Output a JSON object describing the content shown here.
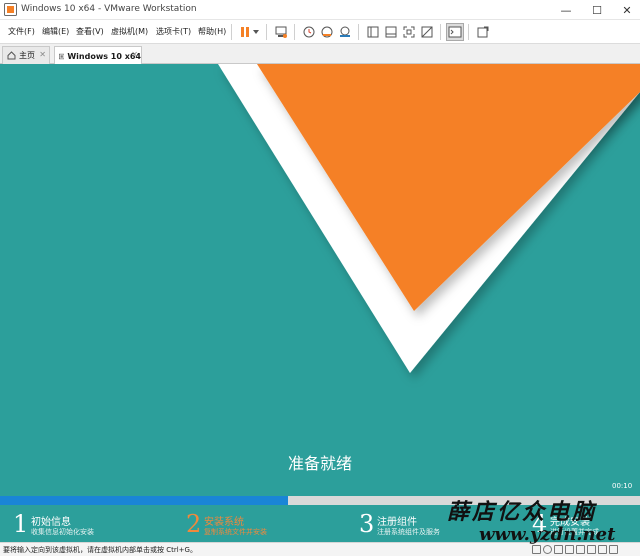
{
  "window": {
    "title": "Windows 10 x64 - VMware Workstation",
    "minimize": "—",
    "maximize": "☐",
    "close": "✕"
  },
  "menu": {
    "items": [
      "文件(F)",
      "编辑(E)",
      "查看(V)",
      "虚拟机(M)",
      "选项卡(T)",
      "帮助(H)"
    ]
  },
  "toolbar": {
    "icons": [
      "pause-icon",
      "dropdown-arrow-icon",
      "send-ctrl-alt-del-icon",
      "snapshot-take-icon",
      "snapshot-revert-icon",
      "snapshot-manager-icon",
      "sidebar-toggle-icon",
      "thumbnail-bar-icon",
      "fullscreen-icon",
      "unity-icon",
      "console-view-icon",
      "stretch-guest-icon"
    ]
  },
  "tabs": [
    {
      "label": "主页",
      "icon": "home-icon",
      "close": "✕"
    },
    {
      "label": "Windows 10 x64",
      "icon": "vm-icon",
      "close": "✕"
    }
  ],
  "vm": {
    "ready_text": "准备就绪",
    "timer": "00:10",
    "progress": 0.45,
    "colors": {
      "background": "#2c9f9b",
      "triangle": "#f58025",
      "border": "#ffffff",
      "progress": "#1a85d6",
      "active_step": "#f0893c"
    },
    "steps": [
      {
        "num": "1",
        "title": "初始信息",
        "desc": "收集信息初始化安装",
        "active": false
      },
      {
        "num": "2",
        "title": "安装系统",
        "desc": "复制系统文件并安装",
        "active": true
      },
      {
        "num": "3",
        "title": "注册组件",
        "desc": "注册系统组件及服务",
        "active": false
      },
      {
        "num": "4",
        "title": "完成安装",
        "desc": "进行设置并完成",
        "active": false
      }
    ]
  },
  "watermark": {
    "brand": "薛店亿众电脑",
    "url": "www.yzdn.net"
  },
  "status": {
    "text": "要将输入定向到该虚拟机，请在虚拟机内部单击或按 Ctrl+G。",
    "icons": [
      "hdd-icon",
      "cdrom-icon",
      "network-icon",
      "usb-icon",
      "sound-icon",
      "printer-icon",
      "display-icon",
      "message-icon"
    ]
  }
}
